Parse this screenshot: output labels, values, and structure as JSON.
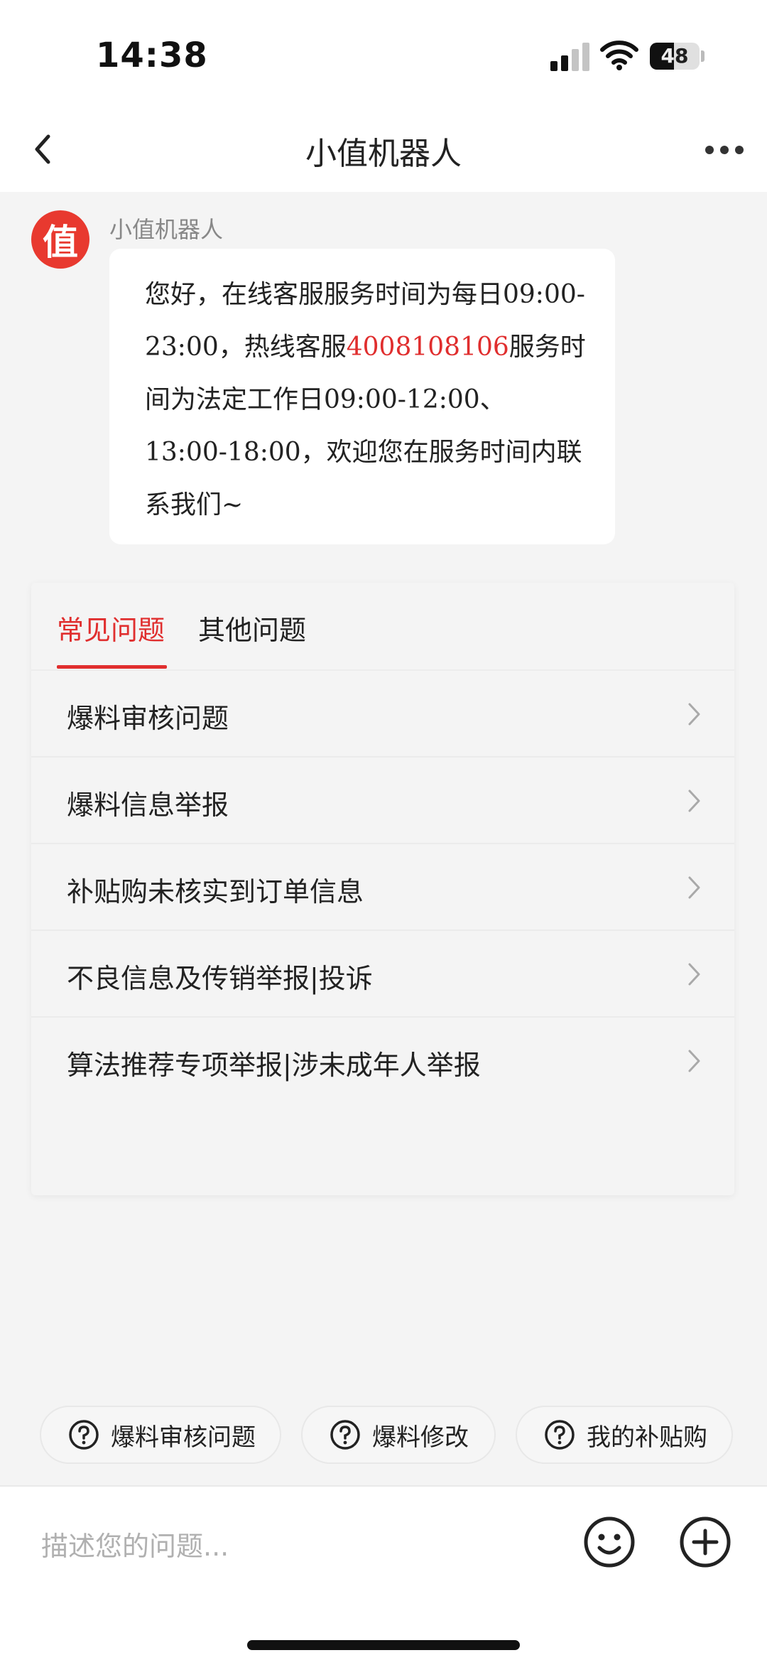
{
  "status_bar": {
    "time": "14:38",
    "battery": "48",
    "icons": [
      "cellular-signal-icon",
      "wifi-icon",
      "battery-icon"
    ]
  },
  "navbar": {
    "title": "小值机器人",
    "back_icon": "chevron-left-icon",
    "more_icon": "more-dots-icon"
  },
  "message": {
    "avatar_text": "值",
    "sender": "小值机器人",
    "text_before_phone": "您好，在线客服服务时间为每日09:00-23:00，热线客服",
    "phone": "4008108106",
    "text_after_phone": "服务时间为法定工作日09:00-12:00、13:00-18:00，欢迎您在服务时间内联系我们~"
  },
  "faq": {
    "tabs": [
      {
        "label": "常见问题",
        "active": true
      },
      {
        "label": "其他问题",
        "active": false
      }
    ],
    "items": [
      {
        "label": "爆料审核问题"
      },
      {
        "label": "爆料信息举报"
      },
      {
        "label": "补贴购未核实到订单信息"
      },
      {
        "label": "不良信息及传销举报|投诉"
      },
      {
        "label": "算法推荐专项举报|涉未成年人举报"
      }
    ]
  },
  "quick_chips": [
    {
      "label": "爆料审核问题",
      "icon": "question-circle-icon"
    },
    {
      "label": "爆料修改",
      "icon": "question-circle-icon"
    },
    {
      "label": "我的补贴购",
      "icon": "question-circle-icon"
    }
  ],
  "input_bar": {
    "placeholder": "描述您的问题...",
    "icons": [
      "emoji-icon",
      "plus-circle-icon"
    ]
  },
  "colors": {
    "accent": "#e02e2e",
    "background": "#f4f4f4",
    "avatar": "#e8392f"
  }
}
